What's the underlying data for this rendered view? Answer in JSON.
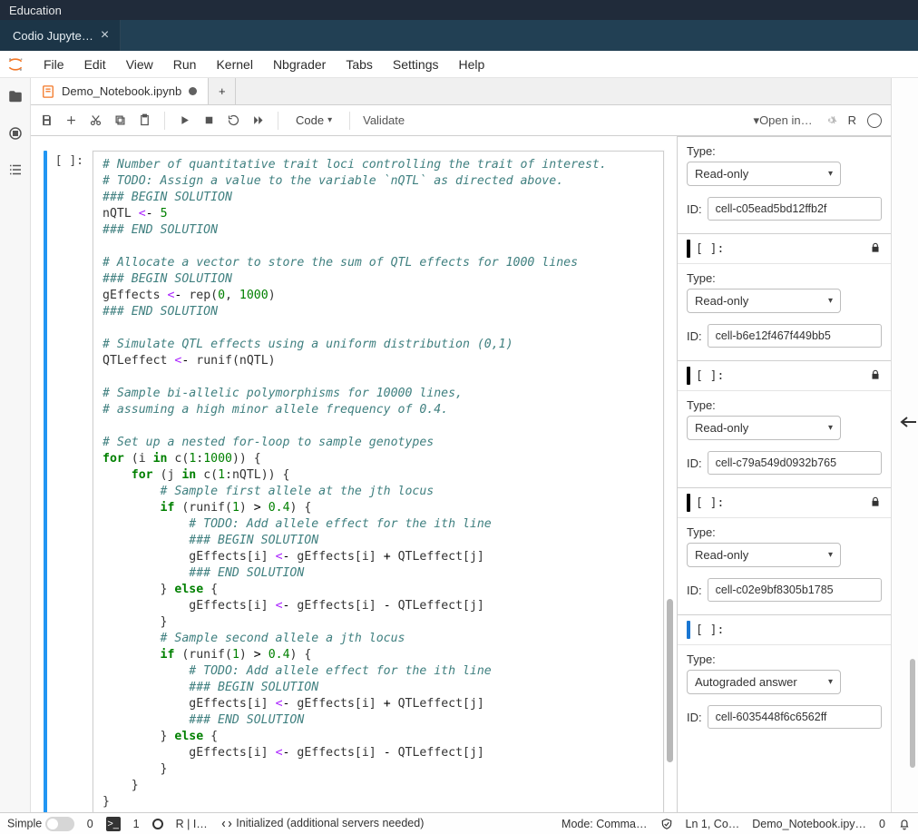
{
  "titlebar": {
    "title": "Education"
  },
  "codio_tab": {
    "label": "Codio Jupyte…",
    "close_glyph": "×"
  },
  "menu": {
    "items": [
      "File",
      "Edit",
      "View",
      "Run",
      "Kernel",
      "Nbgrader",
      "Tabs",
      "Settings",
      "Help"
    ]
  },
  "doc_tabs": {
    "items": [
      {
        "label": "Demo_Notebook.ipynb",
        "dirty": true
      }
    ],
    "add_glyph": "+"
  },
  "toolbar": {
    "cell_type": "Code",
    "validate_label": "Validate",
    "open_in_label": "Open in…",
    "kernel_short": "R"
  },
  "cell": {
    "prompt": "[ ]:",
    "lines": [
      {
        "t": "c",
        "v": "# Number of quantitative trait loci controlling the trait of interest."
      },
      {
        "t": "c",
        "v": "# TODO: Assign a value to the variable `nQTL` as directed above."
      },
      {
        "t": "hc",
        "v": "### BEGIN SOLUTION"
      },
      {
        "t": "code",
        "v": "nQTL <- 5"
      },
      {
        "t": "hc",
        "v": "### END SOLUTION"
      },
      {
        "t": "blank",
        "v": ""
      },
      {
        "t": "c",
        "v": "# Allocate a vector to store the sum of QTL effects for 1000 lines"
      },
      {
        "t": "hc",
        "v": "### BEGIN SOLUTION"
      },
      {
        "t": "code",
        "v": "gEffects <- rep(0, 1000)"
      },
      {
        "t": "hc",
        "v": "### END SOLUTION"
      },
      {
        "t": "blank",
        "v": ""
      },
      {
        "t": "c",
        "v": "# Simulate QTL effects using a uniform distribution (0,1)"
      },
      {
        "t": "code",
        "v": "QTLeffect <- runif(nQTL)"
      },
      {
        "t": "blank",
        "v": ""
      },
      {
        "t": "c",
        "v": "# Sample bi-allelic polymorphisms for 10000 lines,"
      },
      {
        "t": "c",
        "v": "# assuming a high minor allele frequency of 0.4."
      },
      {
        "t": "blank",
        "v": ""
      },
      {
        "t": "c",
        "v": "# Set up a nested for-loop to sample genotypes"
      },
      {
        "t": "code",
        "v": "for (i in c(1:1000)) {"
      },
      {
        "t": "code",
        "v": "    for (j in c(1:nQTL)) {"
      },
      {
        "t": "c",
        "v": "        # Sample first allele at the jth locus"
      },
      {
        "t": "code",
        "v": "        if (runif(1) > 0.4) {"
      },
      {
        "t": "c",
        "v": "            # TODO: Add allele effect for the ith line"
      },
      {
        "t": "hc",
        "v": "            ### BEGIN SOLUTION"
      },
      {
        "t": "code",
        "v": "            gEffects[i] <- gEffects[i] + QTLeffect[j]"
      },
      {
        "t": "hc",
        "v": "            ### END SOLUTION"
      },
      {
        "t": "code",
        "v": "        } else {"
      },
      {
        "t": "code",
        "v": "            gEffects[i] <- gEffects[i] - QTLeffect[j]"
      },
      {
        "t": "code",
        "v": "        }"
      },
      {
        "t": "c",
        "v": "        # Sample second allele a jth locus"
      },
      {
        "t": "code",
        "v": "        if (runif(1) > 0.4) {"
      },
      {
        "t": "c",
        "v": "            # TODO: Add allele effect for the ith line"
      },
      {
        "t": "hc",
        "v": "            ### BEGIN SOLUTION"
      },
      {
        "t": "code",
        "v": "            gEffects[i] <- gEffects[i] + QTLeffect[j]"
      },
      {
        "t": "hc",
        "v": "            ### END SOLUTION"
      },
      {
        "t": "code",
        "v": "        } else {"
      },
      {
        "t": "code",
        "v": "            gEffects[i] <- gEffects[i] - QTLeffect[j]"
      },
      {
        "t": "code",
        "v": "        }"
      },
      {
        "t": "code",
        "v": "    }"
      },
      {
        "t": "code",
        "v": "}"
      }
    ]
  },
  "props": {
    "type_label": "Type:",
    "id_label": "ID:",
    "prompt": "[ ]:",
    "items": [
      {
        "show_header": false,
        "locked": true,
        "type": "Read-only",
        "id": "cell-c05ead5bd12ffb2f"
      },
      {
        "show_header": true,
        "locked": true,
        "type": "Read-only",
        "id": "cell-b6e12f467f449bb5"
      },
      {
        "show_header": true,
        "locked": true,
        "type": "Read-only",
        "id": "cell-c79a549d0932b765"
      },
      {
        "show_header": true,
        "locked": true,
        "type": "Read-only",
        "id": "cell-c02e9bf8305b1785"
      },
      {
        "show_header": true,
        "locked": false,
        "type": "Autograded answer",
        "id": "cell-6035448f6c6562ff",
        "selected": true
      }
    ]
  },
  "status": {
    "simple_label": "Simple",
    "left_num": "0",
    "term_glyph": ">_",
    "left_num2": "1",
    "kernel_label": "R | I…",
    "lsp_label": "Initialized (additional servers needed)",
    "mode_label": "Mode: Comma…",
    "ln_label": "Ln 1, Co…",
    "filename_label": "Demo_Notebook.ipy…",
    "right_num": "0"
  }
}
